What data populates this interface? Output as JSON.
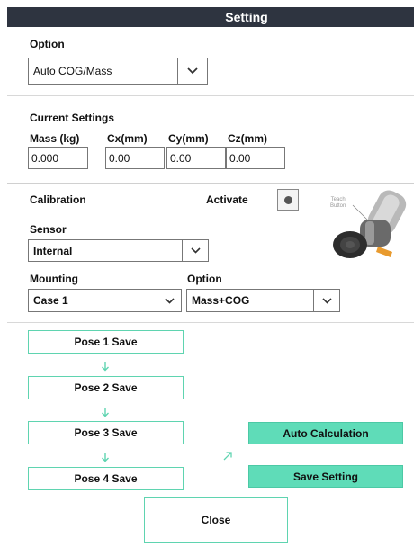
{
  "window": {
    "title": "Setting"
  },
  "option_section": {
    "label": "Option",
    "selected": "Auto COG/Mass"
  },
  "current_settings": {
    "label": "Current Settings",
    "columns": [
      {
        "label": "Mass   (kg)",
        "value": "0.000"
      },
      {
        "label": "Cx(mm)",
        "value": "0.00"
      },
      {
        "label": "Cy(mm)",
        "value": "0.00"
      },
      {
        "label": "Cz(mm)",
        "value": "0.00"
      }
    ]
  },
  "calibration": {
    "label": "Calibration",
    "activate_label": "Activate",
    "teach_button_caption": "Teach\nButton",
    "sensor_label": "Sensor",
    "sensor_value": "Internal",
    "mounting_label": "Mounting",
    "mounting_value": "Case 1",
    "option_label": "Option",
    "option_value": "Mass+COG"
  },
  "poses": [
    {
      "label": "Pose 1 Save"
    },
    {
      "label": "Pose 2 Save"
    },
    {
      "label": "Pose 3 Save"
    },
    {
      "label": "Pose 4 Save"
    }
  ],
  "actions": {
    "auto_calculation": "Auto Calculation",
    "save_setting": "Save Setting",
    "close": "Close"
  },
  "colors": {
    "title_bg": "#2e3440",
    "accent": "#5fdcb8",
    "arrow": "#5fd4b0"
  }
}
